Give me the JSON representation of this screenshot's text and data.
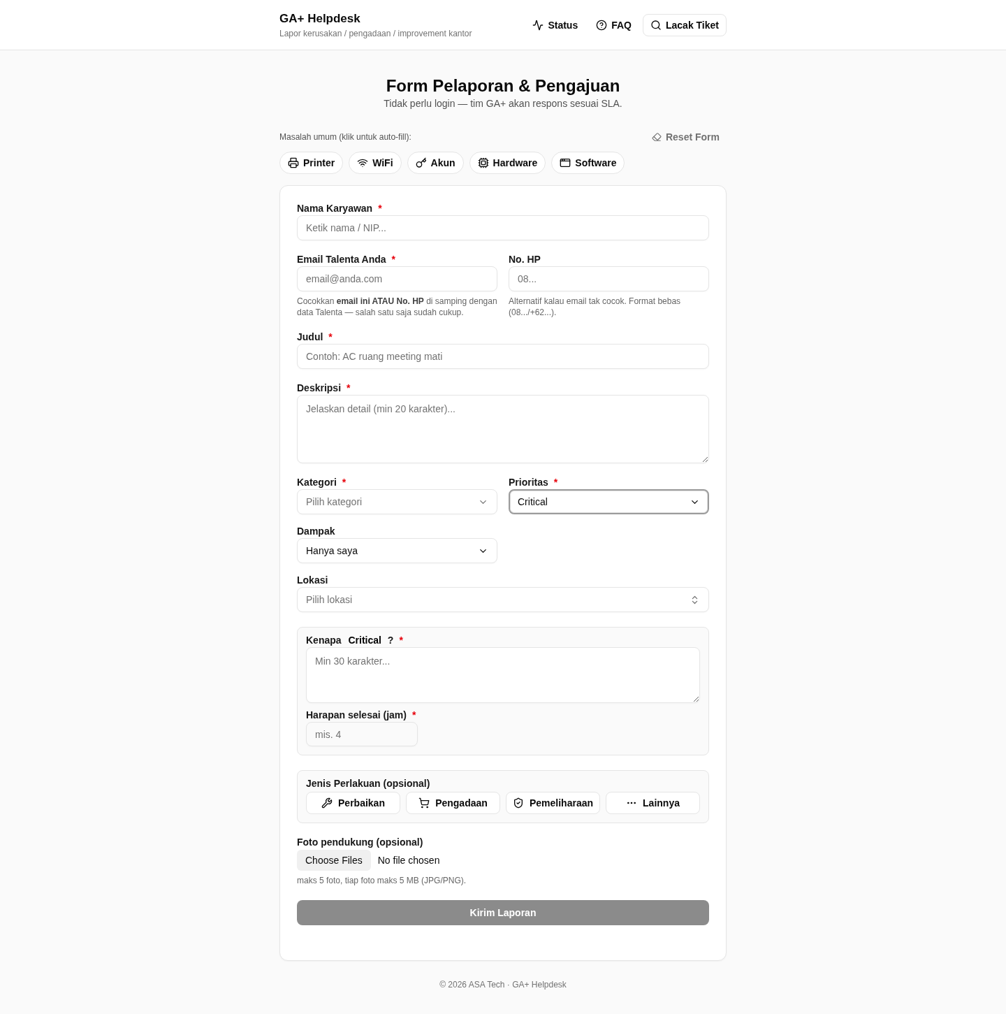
{
  "header": {
    "title": "GA+ Helpdesk",
    "subtitle": "Lapor kerusakan / pengadaan / improvement kantor",
    "nav": [
      {
        "label": "Status",
        "kind": "link"
      },
      {
        "label": "FAQ",
        "kind": "link"
      },
      {
        "label": "Lacak Tiket",
        "kind": "button"
      }
    ]
  },
  "hero": {
    "title": "Form Pelaporan & Pengajuan",
    "subtitle": "Tidak perlu login — tim GA+ akan respons sesuai SLA."
  },
  "quick_fill": {
    "label": "Masalah umum (klik untuk auto-fill):",
    "reset": "Reset Form",
    "chips": [
      {
        "label": "Printer"
      },
      {
        "label": "WiFi"
      },
      {
        "label": "Akun"
      },
      {
        "label": "Hardware"
      },
      {
        "label": "Software"
      }
    ]
  },
  "form": {
    "employee": {
      "label": "Nama Karyawan",
      "required_mark": "*",
      "placeholder": "Ketik nama / NIP..."
    },
    "email": {
      "label": "Email Talenta Anda",
      "required_mark": "*",
      "placeholder": "email@anda.com",
      "help": "Cocokkan **email ini ATAU No. HP** di samping dengan data Talenta — salah satu saja sudah cukup."
    },
    "phone": {
      "label": "No. HP",
      "placeholder": "08...",
      "help": "Alternatif kalau email tak cocok. Format bebas (08.../+62...)."
    },
    "title": {
      "label": "Judul",
      "required_mark": "*",
      "placeholder": "Contoh: AC ruang meeting mati"
    },
    "description": {
      "label": "Deskripsi",
      "required_mark": "*",
      "placeholder": "Jelaskan detail (min 20 karakter)..."
    },
    "category": {
      "label": "Kategori",
      "required_mark": "*",
      "placeholder": "Pilih kategori",
      "focused": false
    },
    "priority": {
      "label": "Prioritas",
      "required_mark": "*",
      "value": "Critical",
      "focused": true
    },
    "impact": {
      "label": "Dampak",
      "value": "Hanya saya",
      "focused": false
    },
    "location": {
      "label": "Lokasi",
      "placeholder": "Pilih lokasi",
      "focused": false
    },
    "reason": {
      "label": "Kenapa **Critical** ?",
      "required_mark": "*",
      "placeholder": "Min 30 karakter...",
      "hours": {
        "label": "Harapan selesai (jam)",
        "required_mark": "*",
        "placeholder": "mis. 4"
      }
    },
    "treatment": {
      "label": "Jenis Perlakuan (opsional)",
      "options": [
        {
          "label": "Perbaikan",
          "selected": false
        },
        {
          "label": "Pengadaan",
          "selected": false
        },
        {
          "label": "Pemeliharaan",
          "selected": false
        },
        {
          "label": "Lainnya",
          "selected": false
        }
      ]
    },
    "photos": {
      "label": "Foto pendukung (opsional)",
      "button": "Choose Files",
      "status": "No file chosen",
      "help": "maks 5 foto, tiap foto maks 5 MB (JPG/PNG)."
    },
    "submit": {
      "label": "Kirim Laporan",
      "disabled": true
    }
  },
  "footer": "© 2026 ASA Tech · GA+ Helpdesk"
}
